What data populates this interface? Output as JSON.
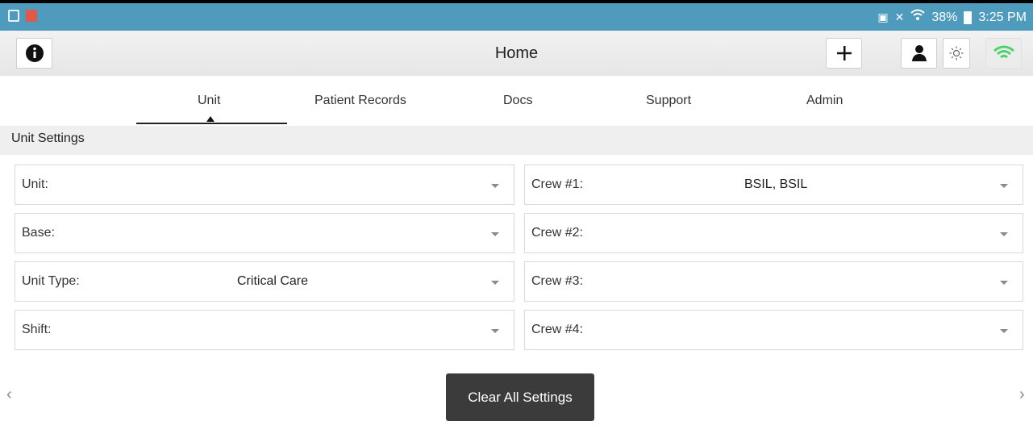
{
  "status_bar": {
    "battery": "38%",
    "time": "3:25 PM",
    "icons": [
      "image-notification-icon",
      "app-notification-icon",
      "cast-icon",
      "mute-icon",
      "wifi-icon",
      "battery-charging-icon"
    ]
  },
  "app_bar": {
    "title": "Home",
    "icons": [
      "info-icon",
      "plus-icon",
      "user-icon",
      "brightness-icon",
      "wifi-icon"
    ],
    "wifi_color": "#4cd16c"
  },
  "tabs": [
    {
      "label": "Unit",
      "active": true
    },
    {
      "label": "Patient Records"
    },
    {
      "label": "Docs"
    },
    {
      "label": "Support"
    },
    {
      "label": "Admin"
    }
  ],
  "section": {
    "title": "Unit Settings"
  },
  "left_fields": [
    {
      "label": "Unit:",
      "value": ""
    },
    {
      "label": "Base:",
      "value": ""
    },
    {
      "label": "Unit Type:",
      "value": "Critical Care"
    },
    {
      "label": "Shift:",
      "value": ""
    }
  ],
  "right_fields": [
    {
      "label": "Crew #1:",
      "value": "BSIL, BSIL"
    },
    {
      "label": "Crew #2:",
      "value": ""
    },
    {
      "label": "Crew #3:",
      "value": ""
    },
    {
      "label": "Crew #4:",
      "value": ""
    }
  ],
  "nav": {
    "prev": "‹",
    "next": "›"
  },
  "clear_button": "Clear All Settings",
  "colors": {
    "status_bar": "#4f9bbd",
    "button_dark": "#3b3b3b"
  }
}
